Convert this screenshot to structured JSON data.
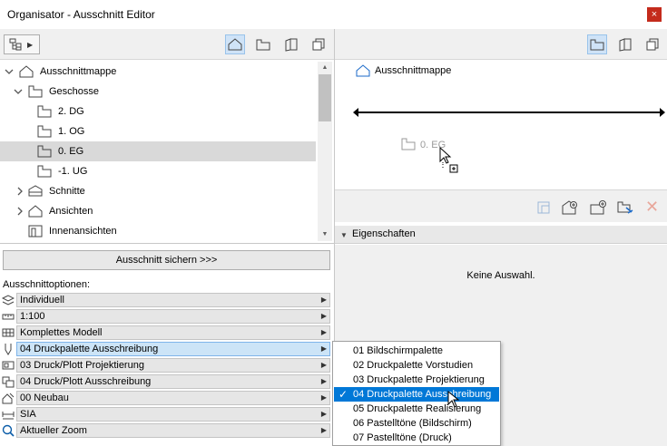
{
  "window": {
    "title": "Organisator - Ausschnitt Editor",
    "close_glyph": "×"
  },
  "left_toolbar": {
    "tree_button_icon": "hierarchy-icon",
    "view_buttons": [
      "project-map-icon",
      "view-map-icon",
      "layout-book-icon",
      "publisher-sets-icon"
    ],
    "active_view": 0
  },
  "tree": {
    "items": [
      {
        "label": "Ausschnittmappe",
        "icon": "view-map-folder-icon",
        "expanded": true
      },
      {
        "label": "Geschosse",
        "icon": "story-icon",
        "expanded": true
      },
      {
        "label": "2. DG",
        "icon": "story-icon"
      },
      {
        "label": "1. OG",
        "icon": "story-icon"
      },
      {
        "label": "0. EG",
        "icon": "story-icon",
        "selected": true
      },
      {
        "label": "-1. UG",
        "icon": "story-icon"
      },
      {
        "label": "Schnitte",
        "icon": "section-icon",
        "expanded": false
      },
      {
        "label": "Ansichten",
        "icon": "elevation-icon",
        "expanded": false
      },
      {
        "label": "Innenansichten",
        "icon": "interior-elevation-icon"
      }
    ]
  },
  "save_button": {
    "label": "Ausschnitt sichern >>>"
  },
  "options": {
    "title": "Ausschnittoptionen:",
    "rows": [
      {
        "value": "Individuell",
        "icon": "layers-icon"
      },
      {
        "value": "1:100",
        "icon": "scale-icon"
      },
      {
        "value": "Komplettes Modell",
        "icon": "structure-display-icon"
      },
      {
        "value": "04 Druckpalette Ausschreibung",
        "icon": "pen-set-icon",
        "active": true
      },
      {
        "value": "03 Druck/Plott Projektierung",
        "icon": "model-view-icon"
      },
      {
        "value": "04 Druck/Plott Ausschreibung",
        "icon": "graphic-override-icon"
      },
      {
        "value": "00 Neubau",
        "icon": "renovation-filter-icon"
      },
      {
        "value": "SIA",
        "icon": "dimension-icon"
      },
      {
        "value": "Aktueller Zoom",
        "icon": "zoom-icon"
      }
    ]
  },
  "right_toolbar": {
    "view_buttons": [
      "view-map-icon",
      "layout-book-icon",
      "publisher-sets-icon"
    ],
    "active_view": 0
  },
  "map_view": {
    "root_label": "Ausschnittmappe",
    "dragging_label": "0. EG"
  },
  "actions": [
    "clone-folder-icon",
    "new-folder-icon",
    "new-view-icon",
    "settings-icon",
    "delete-icon"
  ],
  "properties": {
    "title": "Eigenschaften",
    "empty_text": "Keine Auswahl."
  },
  "popup": {
    "items": [
      "01 Bildschirmpalette",
      "02 Druckpalette Vorstudien",
      "03 Druckpalette Projektierung",
      "04 Druckpalette Ausschreibung",
      "05 Druckpalette Realisierung",
      "06 Pastelltöne (Bildschirm)",
      "07 Pastelltöne (Druck)"
    ],
    "selected_index": 3,
    "check_glyph": "✓"
  },
  "colors": {
    "accent": "#0078d7",
    "active_button": "#cfe3f7",
    "close": "#c42b1c",
    "selected_row": "#d9d9d9"
  }
}
